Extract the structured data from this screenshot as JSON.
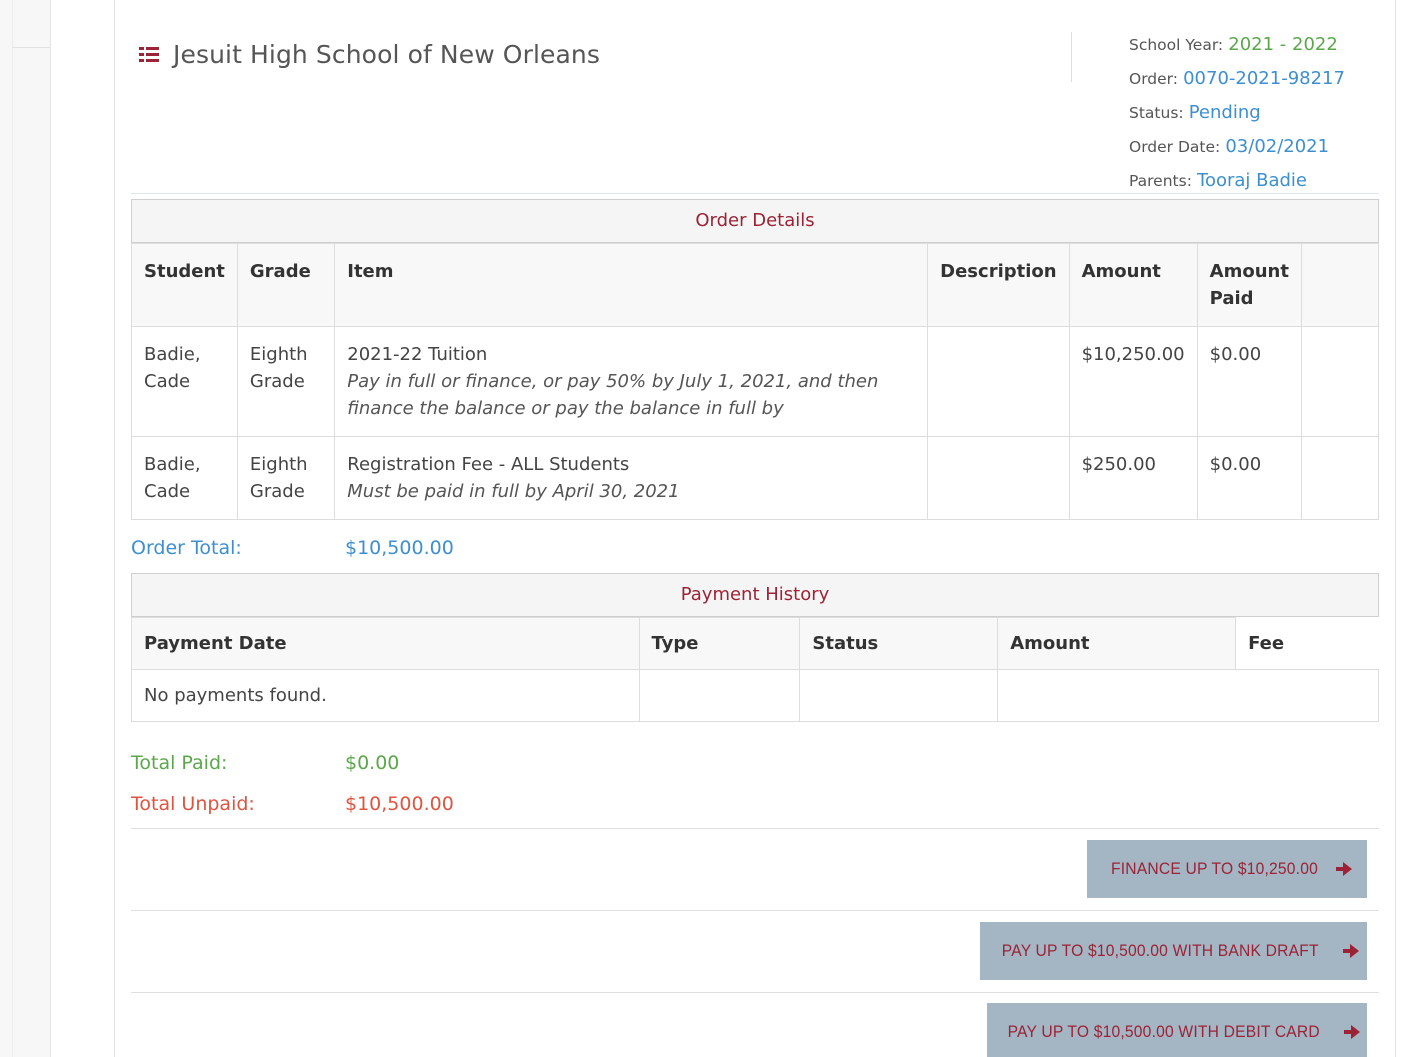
{
  "header": {
    "school_name": "Jesuit High School of New Orleans",
    "school_year_label": "School Year:",
    "school_year": "2021 - 2022",
    "order_label": "Order:",
    "order_number": "0070-2021-98217",
    "status_label": "Status:",
    "status": "Pending",
    "order_date_label": "Order Date:",
    "order_date": "03/02/2021",
    "parents_label": "Parents:",
    "parents": "Tooraj Badie"
  },
  "order_details": {
    "caption": "Order Details",
    "columns": [
      "Student",
      "Grade",
      "Item",
      "Description",
      "Amount",
      "Amount Paid",
      ""
    ],
    "rows": [
      {
        "student": "Badie, Cade",
        "grade": "Eighth Grade",
        "item": "2021-22 Tuition",
        "item_note": "Pay in full or finance, or pay 50% by July 1, 2021, and then finance the balance or pay the balance in full by",
        "description": "",
        "amount": "$10,250.00",
        "amount_paid": "$0.00"
      },
      {
        "student": "Badie, Cade",
        "grade": "Eighth Grade",
        "item": "Registration Fee - ALL Students",
        "item_note": "Must be paid in full by April 30, 2021",
        "description": "",
        "amount": "$250.00",
        "amount_paid": "$0.00"
      }
    ]
  },
  "order_total": {
    "label": "Order Total:",
    "value": "$10,500.00"
  },
  "payment_history": {
    "caption": "Payment History",
    "columns": [
      "Payment Date",
      "Type",
      "Status",
      "Amount",
      "Fee"
    ],
    "empty_message": "No payments found."
  },
  "totals": {
    "paid_label": "Total Paid:",
    "paid_value": "$0.00",
    "unpaid_label": "Total Unpaid:",
    "unpaid_value": "$10,500.00"
  },
  "actions": {
    "finance_label": "FINANCE UP TO $10,250.00",
    "bank_draft_label": "PAY UP TO $10,500.00 WITH BANK DRAFT",
    "debit_card_label": "PAY UP TO $10,500.00 WITH DEBIT CARD"
  },
  "colors": {
    "accent_maroon": "#9b2335",
    "link_blue": "#3d8fd1",
    "paid_green": "#5ba84a",
    "unpaid_red": "#e0533e",
    "button_bg": "#a4b5c4"
  }
}
